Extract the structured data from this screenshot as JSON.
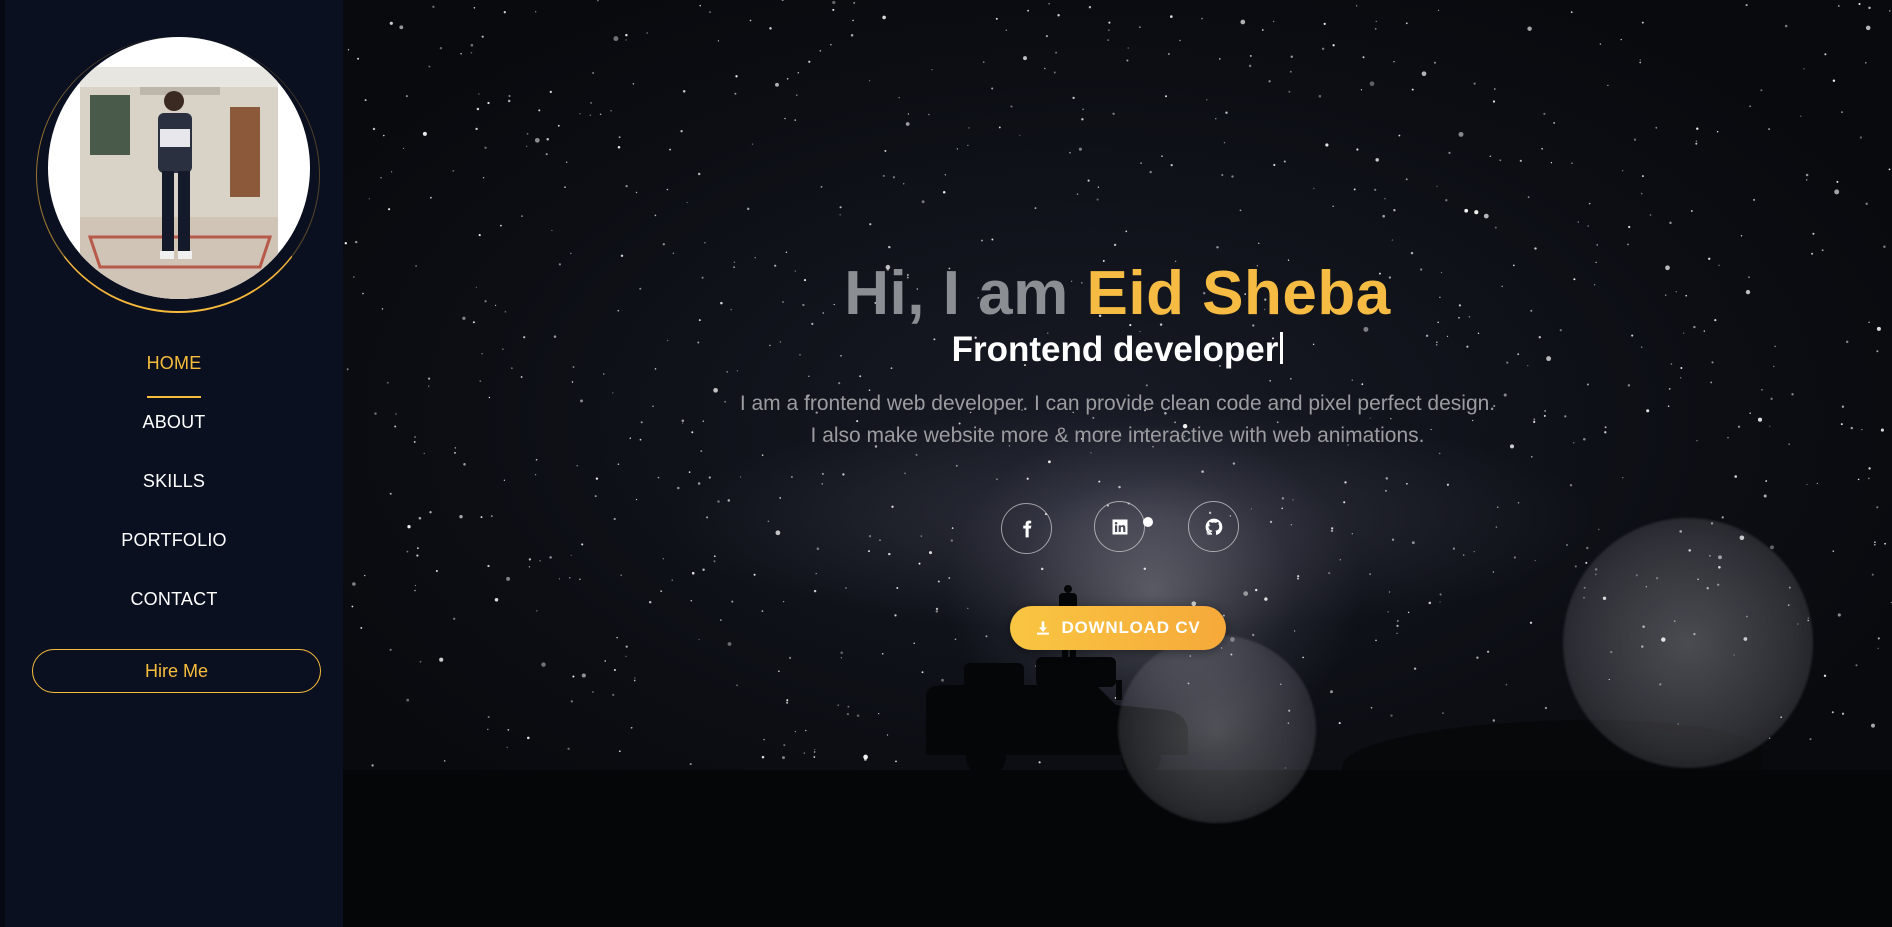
{
  "sidebar": {
    "nav": [
      {
        "label": "HOME",
        "active": true
      },
      {
        "label": "ABOUT",
        "active": false
      },
      {
        "label": "SKILLS",
        "active": false
      },
      {
        "label": "PORTFOLIO",
        "active": false
      },
      {
        "label": "CONTACT",
        "active": false
      }
    ],
    "hire_label": "Hire Me"
  },
  "hero": {
    "greeting": "Hi, I am",
    "name": "Eid Sheba",
    "role": "Frontend developer",
    "description_line1": "I am a frontend web developer. I can provide clean code and pixel perfect design.",
    "description_line2": "I also make website more & more interactive with web animations.",
    "socials": [
      {
        "icon": "facebook-icon"
      },
      {
        "icon": "linkedin-icon"
      },
      {
        "icon": "github-icon"
      }
    ],
    "download_label": "DOWNLOAD CV",
    "download_icon": "download-icon"
  },
  "colors": {
    "accent": "#f8bd3b",
    "sidebar_bg": "#0b1020",
    "greeting": "#8b8e92",
    "text": "#ffffff"
  }
}
